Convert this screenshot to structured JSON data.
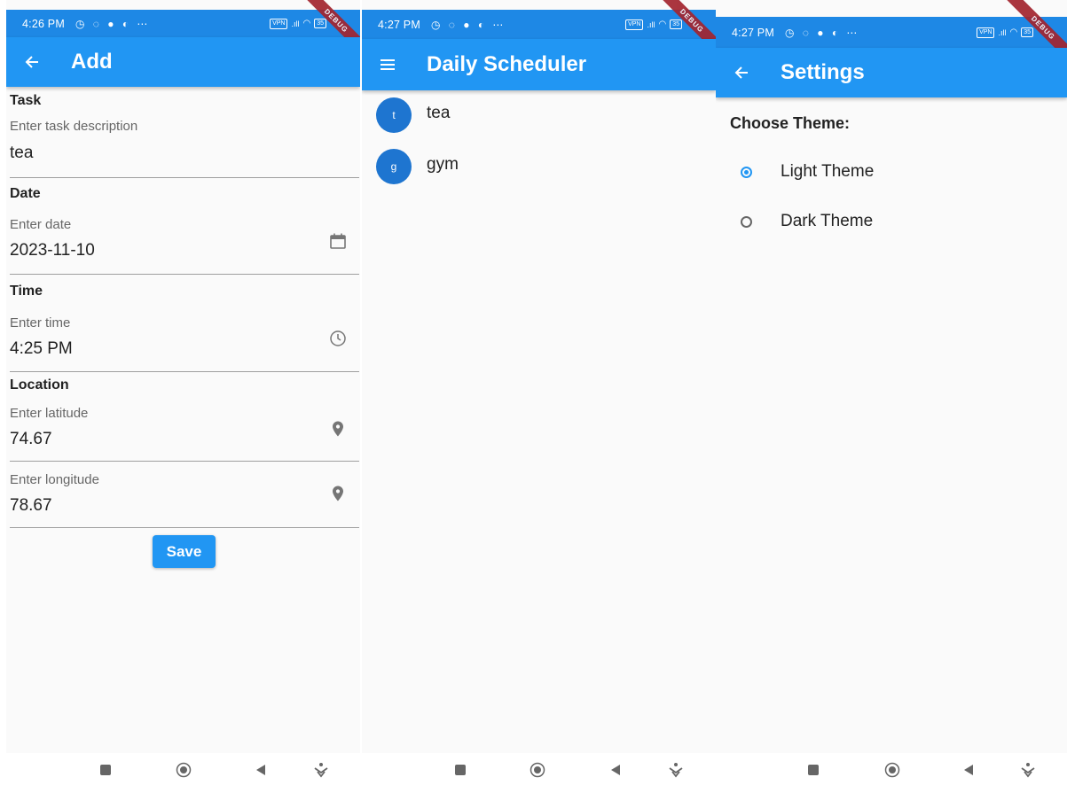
{
  "screens": {
    "add": {
      "status_time": "4:26 PM",
      "title": "Add",
      "sections": {
        "task": "Task",
        "date": "Date",
        "time": "Time",
        "location": "Location"
      },
      "fields": {
        "task": {
          "label": "Enter task description",
          "value": "tea"
        },
        "date": {
          "label": "Enter date",
          "value": "2023-11-10"
        },
        "time": {
          "label": "Enter time",
          "value": "4:25 PM"
        },
        "latitude": {
          "label": "Enter latitude",
          "value": "74.67"
        },
        "longitude": {
          "label": "Enter longitude",
          "value": "78.67"
        }
      },
      "save_label": "Save"
    },
    "scheduler": {
      "status_time": "4:27 PM",
      "title": "Daily Scheduler",
      "tasks": [
        {
          "initial": "t",
          "title": "tea"
        },
        {
          "initial": "g",
          "title": "gym"
        }
      ]
    },
    "settings": {
      "status_time": "4:27 PM",
      "title": "Settings",
      "heading": "Choose Theme:",
      "options": [
        {
          "label": "Light Theme",
          "selected": true
        },
        {
          "label": "Dark Theme",
          "selected": false
        }
      ]
    }
  },
  "status": {
    "vpn": "VPN",
    "battery": "35",
    "debug_banner": "DEBUG"
  },
  "colors": {
    "primary": "#2196f3",
    "status_bar": "#1e88e5",
    "avatar": "#1e75d0",
    "debug_ribbon": "#a3252f"
  }
}
